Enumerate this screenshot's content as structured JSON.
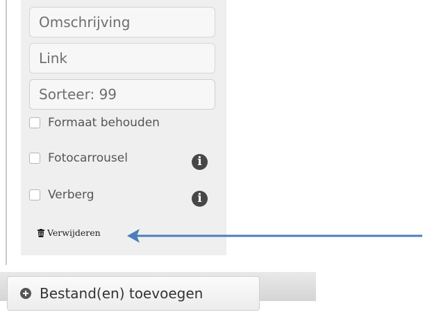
{
  "form": {
    "description_placeholder": "Omschrijving",
    "link_placeholder": "Link",
    "sort_value": "Sorteer: 99"
  },
  "options": {
    "keep_format_label": "Formaat behouden",
    "photo_carousel_label": "Fotocarrousel",
    "hide_label": "Verberg",
    "info_icon_glyph": "i"
  },
  "actions": {
    "delete_label": "Verwijderen",
    "delete_icon": "trash-icon",
    "add_files_label": "Bestand(en) toevoegen",
    "add_files_icon": "plus-circle-icon"
  },
  "annotation": {
    "arrow_color": "#4a7ebb"
  }
}
